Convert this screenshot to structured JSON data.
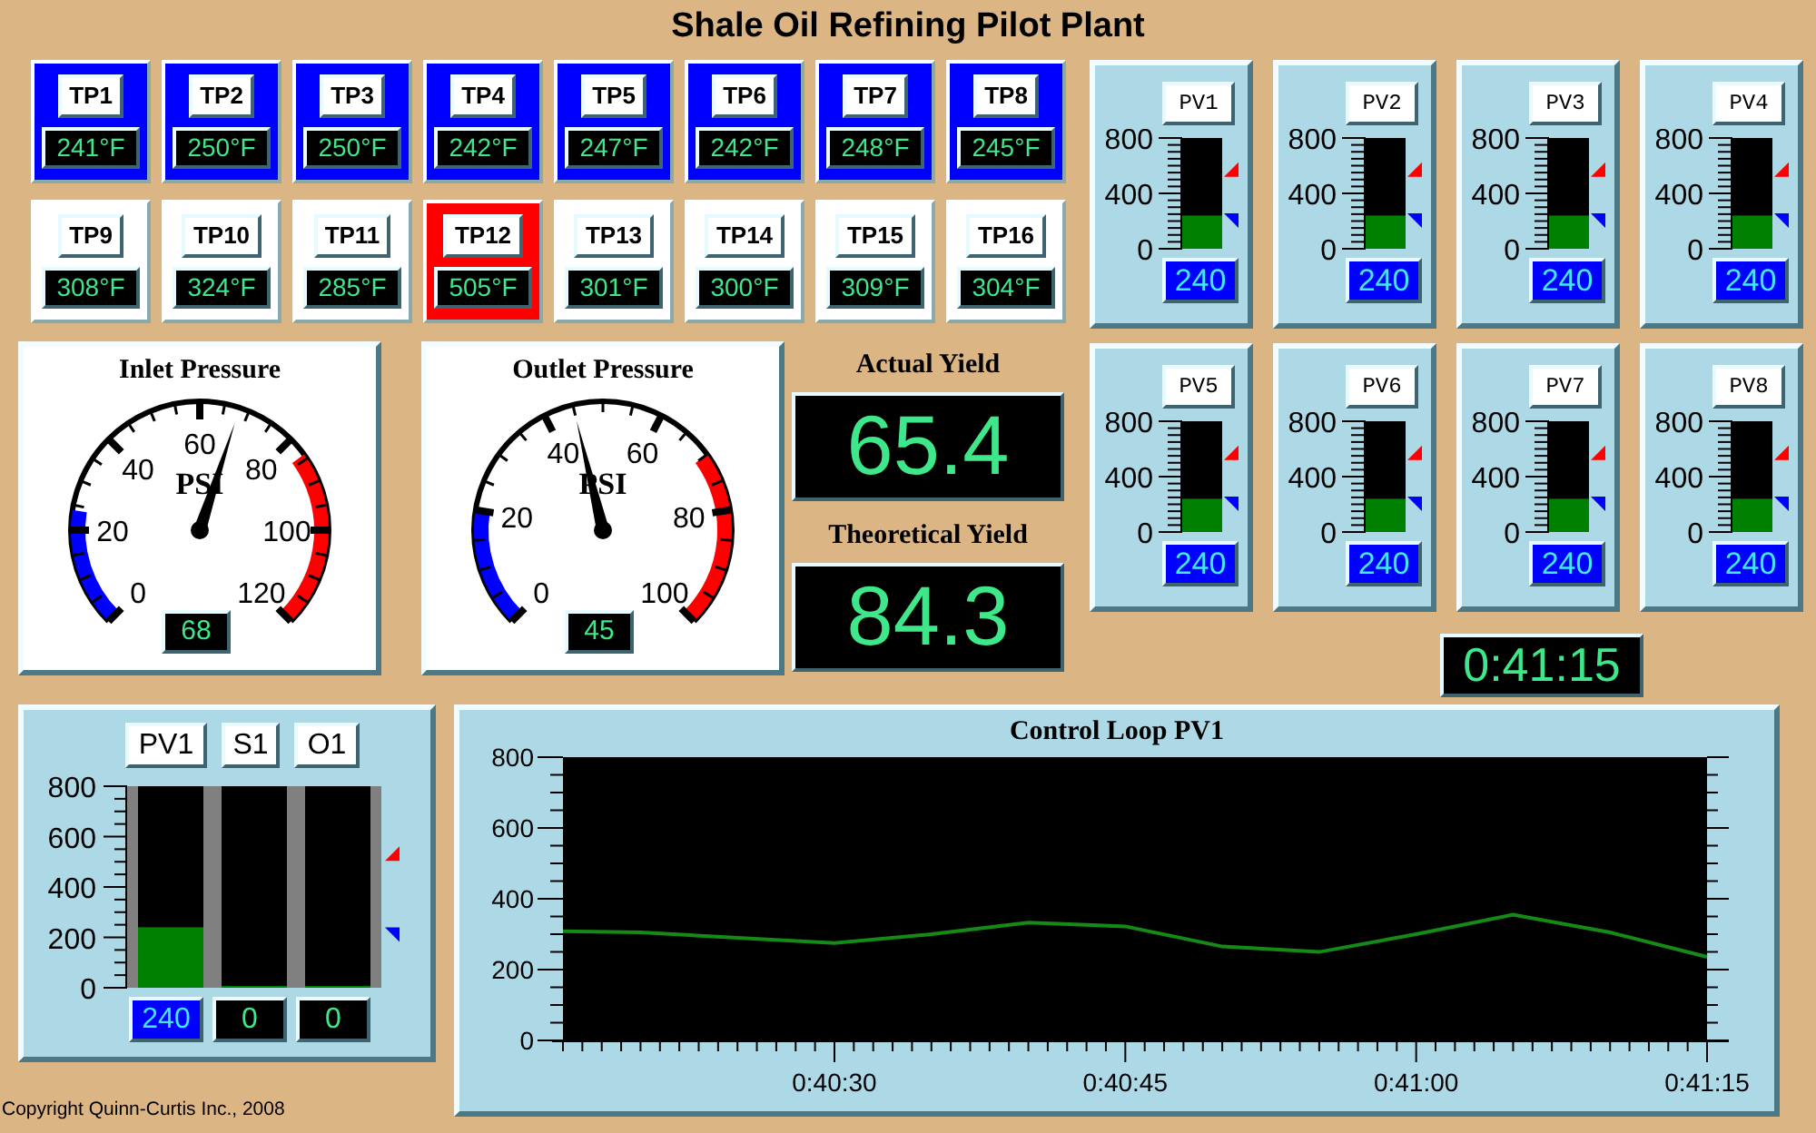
{
  "title": "Shale Oil Refining Pilot Plant",
  "temperature_points": [
    {
      "label": "TP1",
      "value": "241°F",
      "color": "#0000ff"
    },
    {
      "label": "TP2",
      "value": "250°F",
      "color": "#0000ff"
    },
    {
      "label": "TP3",
      "value": "250°F",
      "color": "#0000ff"
    },
    {
      "label": "TP4",
      "value": "242°F",
      "color": "#0000ff"
    },
    {
      "label": "TP5",
      "value": "247°F",
      "color": "#0000ff"
    },
    {
      "label": "TP6",
      "value": "242°F",
      "color": "#0000ff"
    },
    {
      "label": "TP7",
      "value": "248°F",
      "color": "#0000ff"
    },
    {
      "label": "TP8",
      "value": "245°F",
      "color": "#0000ff"
    },
    {
      "label": "TP9",
      "value": "308°F",
      "color": "#ffffff"
    },
    {
      "label": "TP10",
      "value": "324°F",
      "color": "#ffffff"
    },
    {
      "label": "TP11",
      "value": "285°F",
      "color": "#ffffff"
    },
    {
      "label": "TP12",
      "value": "505°F",
      "color": "#ff0000"
    },
    {
      "label": "TP13",
      "value": "301°F",
      "color": "#ffffff"
    },
    {
      "label": "TP14",
      "value": "300°F",
      "color": "#ffffff"
    },
    {
      "label": "TP15",
      "value": "309°F",
      "color": "#ffffff"
    },
    {
      "label": "TP16",
      "value": "304°F",
      "color": "#ffffff"
    }
  ],
  "gauges": [
    {
      "title": "Inlet Pressure",
      "unit": "PSI",
      "scale": [
        "0",
        "20",
        "40",
        "60",
        "80",
        "100",
        "120"
      ],
      "level": 0.567,
      "value": "68"
    },
    {
      "title": "Outlet Pressure",
      "unit": "PSI",
      "scale": [
        "0",
        "20",
        "40",
        "60",
        "80",
        "100"
      ],
      "level": 0.45,
      "value": "45"
    }
  ],
  "yields": [
    {
      "title": "Actual Yield",
      "value": "65.4"
    },
    {
      "title": "Theoretical Yield",
      "value": "84.3"
    }
  ],
  "process_meters": [
    {
      "label": "PV1",
      "scale": [
        "800",
        "400",
        "0"
      ],
      "level": 0.3,
      "value": "240"
    },
    {
      "label": "PV2",
      "scale": [
        "800",
        "400",
        "0"
      ],
      "level": 0.3,
      "value": "240"
    },
    {
      "label": "PV3",
      "scale": [
        "800",
        "400",
        "0"
      ],
      "level": 0.3,
      "value": "240"
    },
    {
      "label": "PV4",
      "scale": [
        "800",
        "400",
        "0"
      ],
      "level": 0.3,
      "value": "240"
    },
    {
      "label": "PV5",
      "scale": [
        "800",
        "400",
        "0"
      ],
      "level": 0.3,
      "value": "240"
    },
    {
      "label": "PV6",
      "scale": [
        "800",
        "400",
        "0"
      ],
      "level": 0.3,
      "value": "240"
    },
    {
      "label": "PV7",
      "scale": [
        "800",
        "400",
        "0"
      ],
      "level": 0.3,
      "value": "240"
    },
    {
      "label": "PV8",
      "scale": [
        "800",
        "400",
        "0"
      ],
      "level": 0.3,
      "value": "240"
    }
  ],
  "clock": "0:41:15",
  "loop_meters": {
    "scale": [
      "800",
      "600",
      "400",
      "200",
      "0"
    ],
    "bars": [
      {
        "label": "PV1",
        "kind": "process",
        "level": 0.3,
        "value": "240"
      },
      {
        "label": "S1",
        "kind": "setpoint",
        "level": 0,
        "value": "0"
      },
      {
        "label": "O1",
        "kind": "output",
        "level": 0,
        "value": "0"
      }
    ]
  },
  "trend": {
    "chart_data": {
      "type": "line",
      "title": "Control Loop PV1",
      "x": [
        2416,
        2420,
        2425,
        2430,
        2435,
        2440,
        2445,
        2450,
        2455,
        2460,
        2465,
        2470,
        2475
      ],
      "series": [
        {
          "color": "#168a16",
          "values": [
            308,
            305,
            290,
            275,
            300,
            333,
            322,
            265,
            250,
            300,
            355,
            305,
            236
          ]
        }
      ],
      "xlim": [
        2416,
        2475
      ],
      "ylim": [
        0,
        800
      ],
      "xticks": [
        {
          "value": 2430,
          "label": "0:40:30"
        },
        {
          "value": 2445,
          "label": "0:40:45"
        },
        {
          "value": 2460,
          "label": "0:41:00"
        },
        {
          "value": 2475,
          "label": "0:41:15"
        }
      ],
      "yticks": [
        0,
        200,
        400,
        600,
        800
      ]
    }
  },
  "copyright": "Copyright Quinn-Curtis Inc., 2008"
}
